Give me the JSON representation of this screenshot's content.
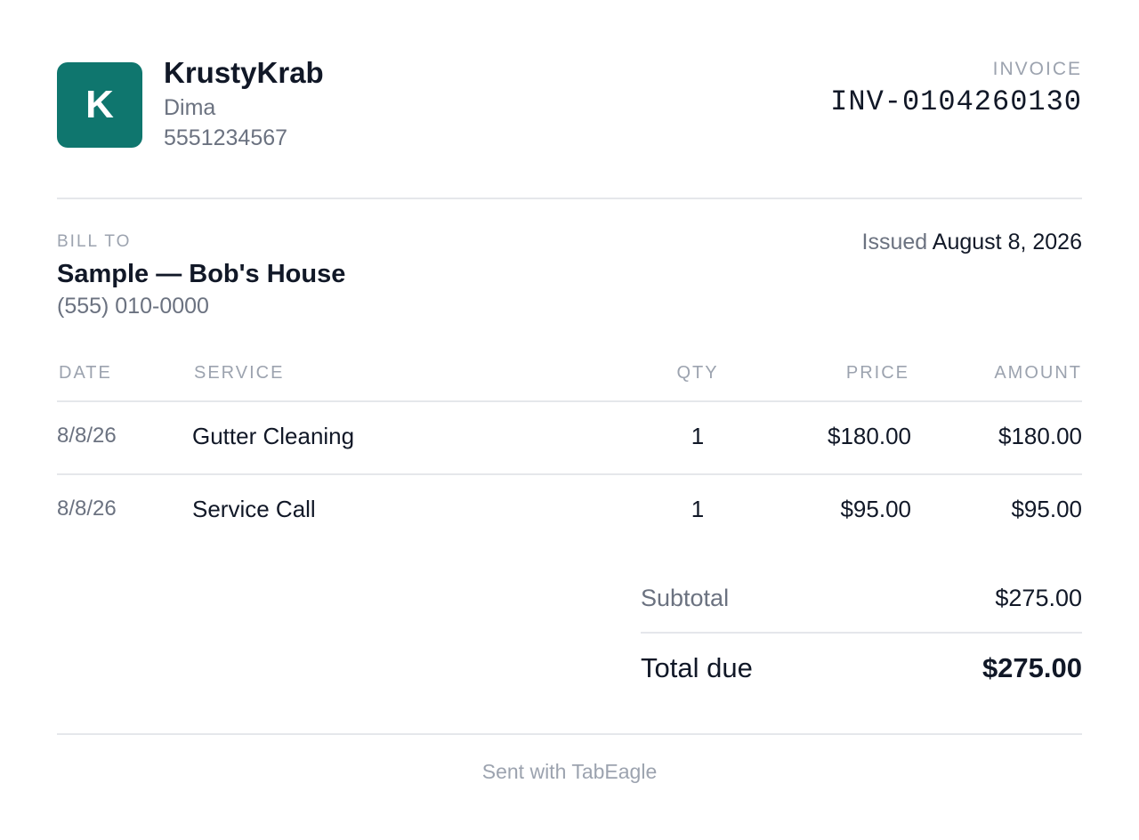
{
  "business": {
    "logo_letter": "K",
    "name": "KrustyKrab",
    "contact": "Dima",
    "phone": "5551234567"
  },
  "invoice": {
    "label": "INVOICE",
    "number": "INV-0104260130"
  },
  "bill_to": {
    "label": "BILL TO",
    "name": "Sample — Bob's House",
    "phone": "(555) 010-0000"
  },
  "issued": {
    "label": "Issued",
    "date": "August 8, 2026"
  },
  "table": {
    "headers": {
      "date": "DATE",
      "service": "SERVICE",
      "qty": "QTY",
      "price": "PRICE",
      "amount": "AMOUNT"
    },
    "rows": [
      {
        "date": "8/8/26",
        "service": "Gutter Cleaning",
        "qty": "1",
        "price": "$180.00",
        "amount": "$180.00"
      },
      {
        "date": "8/8/26",
        "service": "Service Call",
        "qty": "1",
        "price": "$95.00",
        "amount": "$95.00"
      }
    ]
  },
  "summary": {
    "subtotal_label": "Subtotal",
    "subtotal_value": "$275.00",
    "total_label": "Total due",
    "total_value": "$275.00"
  },
  "footer": {
    "text": "Sent with TabEagle"
  },
  "colors": {
    "brand": "#0f766e",
    "text_primary": "#111827",
    "text_secondary": "#6b7280",
    "text_muted": "#9ca3af",
    "divider": "#e5e7eb"
  }
}
